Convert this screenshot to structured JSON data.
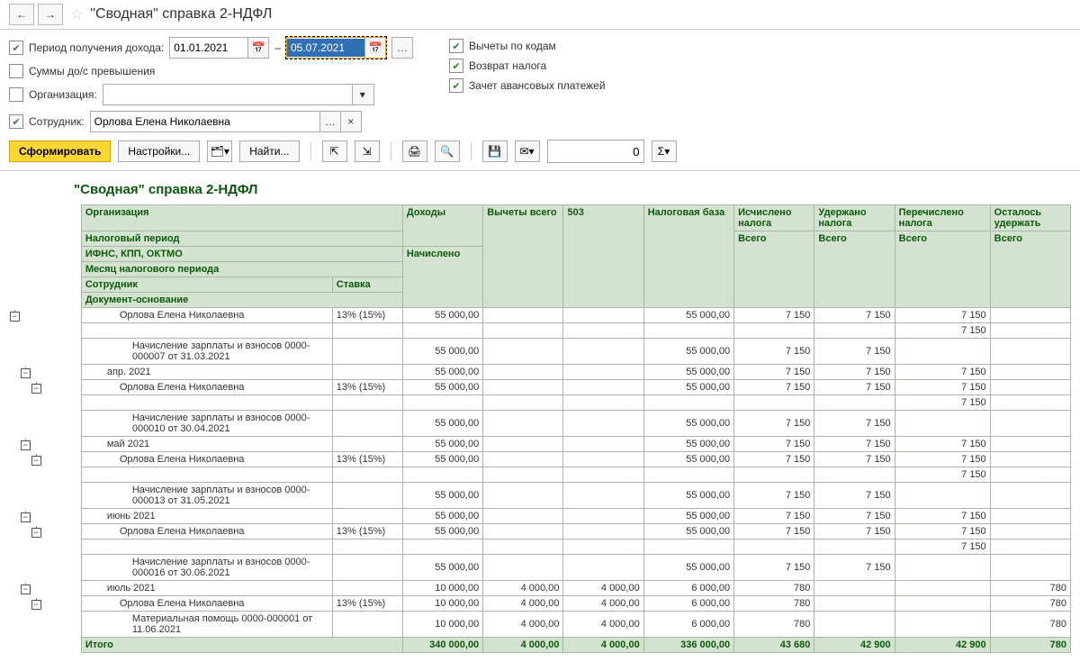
{
  "window": {
    "title": "\"Сводная\" справка 2-НДФЛ"
  },
  "filters": {
    "period_label": "Период получения дохода:",
    "date_from": "01.01.2021",
    "date_sep": "–",
    "date_to": "05.07.2021",
    "sums_label": "Суммы до/с превышения",
    "org_label": "Организация:",
    "org_value": "",
    "emp_label": "Сотрудник:",
    "emp_value": "Орлова Елена Николаевна",
    "deduct_codes": "Вычеты по кодам",
    "tax_refund": "Возврат налога",
    "advance": "Зачет авансовых платежей"
  },
  "actions": {
    "form": "Сформировать",
    "settings": "Настройки...",
    "find": "Найти...",
    "num_value": "0"
  },
  "report": {
    "title": "\"Сводная\" справка 2-НДФЛ",
    "hdr": {
      "org": "Организация",
      "income": "Доходы",
      "deduct_total": "Вычеты всего",
      "c503": "503",
      "tax_base": "Налоговая база",
      "calc_tax": "Исчислено налога",
      "withheld": "Удержано налога",
      "transferred": "Перечислено налога",
      "remain": "Осталось удержать",
      "period_tax": "Налоговый период",
      "accrued": "Начислено",
      "total": "Всего",
      "ifns": "ИФНС, КПП, ОКТМО",
      "month": "Месяц налогового периода",
      "employee": "Сотрудник",
      "rate": "Ставка",
      "doc": "Документ-основание"
    },
    "rows": [
      {
        "tree": "0-----",
        "cls": "pad3",
        "name": "Орлова Елена Николаевна",
        "rate": "13% (15%)",
        "income": "55 000,00",
        "d": "",
        "c": "",
        "base": "55 000,00",
        "calc": "7 150",
        "with": "7 150",
        "tr": "7 150",
        "rem": ""
      },
      {
        "tree": "------",
        "cls": "pad3",
        "name": "",
        "rate": "",
        "income": "",
        "d": "",
        "c": "",
        "base": "",
        "calc": "",
        "with": "",
        "tr": "7 150",
        "rem": ""
      },
      {
        "tree": "------",
        "cls": "pad4",
        "name": "Начисление зарплаты и взносов 0000-000007 от 31.03.2021",
        "rate": "",
        "income": "55 000,00",
        "d": "",
        "c": "",
        "base": "55 000,00",
        "calc": "7 150",
        "with": "7 150",
        "tr": "",
        "rem": ""
      },
      {
        "tree": "-0----",
        "cls": "pad2",
        "name": "апр. 2021",
        "rate": "",
        "income": "55 000,00",
        "d": "",
        "c": "",
        "base": "55 000,00",
        "calc": "7 150",
        "with": "7 150",
        "tr": "7 150",
        "rem": ""
      },
      {
        "tree": "--0---",
        "cls": "pad3",
        "name": "Орлова Елена Николаевна",
        "rate": "13% (15%)",
        "income": "55 000,00",
        "d": "",
        "c": "",
        "base": "55 000,00",
        "calc": "7 150",
        "with": "7 150",
        "tr": "7 150",
        "rem": ""
      },
      {
        "tree": "------",
        "cls": "pad3",
        "name": "",
        "rate": "",
        "income": "",
        "d": "",
        "c": "",
        "base": "",
        "calc": "",
        "with": "",
        "tr": "7 150",
        "rem": ""
      },
      {
        "tree": "------",
        "cls": "pad4",
        "name": "Начисление зарплаты и взносов 0000-000010 от 30.04.2021",
        "rate": "",
        "income": "55 000,00",
        "d": "",
        "c": "",
        "base": "55 000,00",
        "calc": "7 150",
        "with": "7 150",
        "tr": "",
        "rem": ""
      },
      {
        "tree": "-0----",
        "cls": "pad2",
        "name": "май 2021",
        "rate": "",
        "income": "55 000,00",
        "d": "",
        "c": "",
        "base": "55 000,00",
        "calc": "7 150",
        "with": "7 150",
        "tr": "7 150",
        "rem": ""
      },
      {
        "tree": "--0---",
        "cls": "pad3",
        "name": "Орлова Елена Николаевна",
        "rate": "13% (15%)",
        "income": "55 000,00",
        "d": "",
        "c": "",
        "base": "55 000,00",
        "calc": "7 150",
        "with": "7 150",
        "tr": "7 150",
        "rem": ""
      },
      {
        "tree": "------",
        "cls": "pad3",
        "name": "",
        "rate": "",
        "income": "",
        "d": "",
        "c": "",
        "base": "",
        "calc": "",
        "with": "",
        "tr": "7 150",
        "rem": ""
      },
      {
        "tree": "------",
        "cls": "pad4",
        "name": "Начисление зарплаты и взносов 0000-000013 от 31.05.2021",
        "rate": "",
        "income": "55 000,00",
        "d": "",
        "c": "",
        "base": "55 000,00",
        "calc": "7 150",
        "with": "7 150",
        "tr": "",
        "rem": ""
      },
      {
        "tree": "-0----",
        "cls": "pad2",
        "name": "июнь 2021",
        "rate": "",
        "income": "55 000,00",
        "d": "",
        "c": "",
        "base": "55 000,00",
        "calc": "7 150",
        "with": "7 150",
        "tr": "7 150",
        "rem": ""
      },
      {
        "tree": "--0---",
        "cls": "pad3",
        "name": "Орлова Елена Николаевна",
        "rate": "13% (15%)",
        "income": "55 000,00",
        "d": "",
        "c": "",
        "base": "55 000,00",
        "calc": "7 150",
        "with": "7 150",
        "tr": "7 150",
        "rem": ""
      },
      {
        "tree": "------",
        "cls": "pad3",
        "name": "",
        "rate": "",
        "income": "",
        "d": "",
        "c": "",
        "base": "",
        "calc": "",
        "with": "",
        "tr": "7 150",
        "rem": ""
      },
      {
        "tree": "------",
        "cls": "pad4",
        "name": "Начисление зарплаты и взносов 0000-000016 от 30.06.2021",
        "rate": "",
        "income": "55 000,00",
        "d": "",
        "c": "",
        "base": "55 000,00",
        "calc": "7 150",
        "with": "7 150",
        "tr": "",
        "rem": ""
      },
      {
        "tree": "-0----",
        "cls": "pad2",
        "name": "июль 2021",
        "rate": "",
        "income": "10 000,00",
        "d": "4 000,00",
        "c": "4 000,00",
        "base": "6 000,00",
        "calc": "780",
        "with": "",
        "tr": "",
        "rem": "780"
      },
      {
        "tree": "--0---",
        "cls": "pad3",
        "name": "Орлова Елена Николаевна",
        "rate": "13% (15%)",
        "income": "10 000,00",
        "d": "4 000,00",
        "c": "4 000,00",
        "base": "6 000,00",
        "calc": "780",
        "with": "",
        "tr": "",
        "rem": "780"
      },
      {
        "tree": "------",
        "cls": "pad4",
        "name": "Материальная помощь 0000-000001 от 11.06.2021",
        "rate": "",
        "income": "10 000,00",
        "d": "4 000,00",
        "c": "4 000,00",
        "base": "6 000,00",
        "calc": "780",
        "with": "",
        "tr": "",
        "rem": "780"
      }
    ],
    "totals": {
      "label": "Итого",
      "income": "340 000,00",
      "d": "4 000,00",
      "c": "4 000,00",
      "base": "336 000,00",
      "calc": "43 680",
      "with": "42 900",
      "tr": "42 900",
      "rem": "780"
    }
  }
}
